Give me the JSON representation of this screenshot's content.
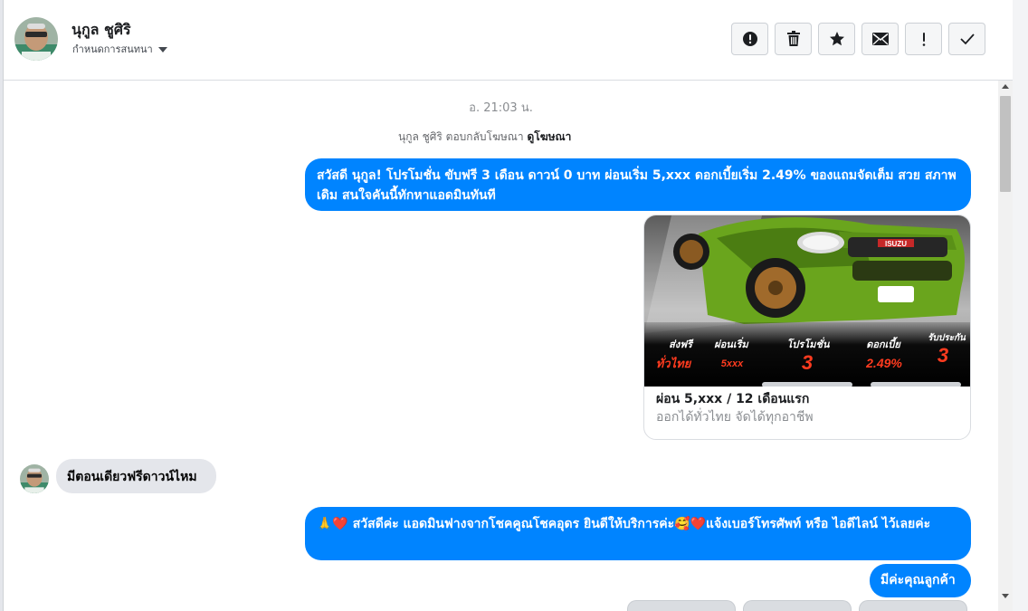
{
  "header": {
    "name": "นุกูล ชูศิริ",
    "subtitle": "กำหนดการสนทนา",
    "actions": [
      {
        "icon": "alert-circle-icon"
      },
      {
        "icon": "trash-icon"
      },
      {
        "icon": "star-icon"
      },
      {
        "icon": "envelope-icon"
      },
      {
        "icon": "exclamation-icon"
      },
      {
        "icon": "check-icon"
      }
    ]
  },
  "thread": {
    "timestamp": "อ. 21:03 น.",
    "reply_note": "นุกูล ชูศิริ ตอบกลับโฆษณา",
    "reply_link": "ดูโฆษณา",
    "messages": [
      {
        "direction": "outgoing",
        "text": "สวัสดี นุกูล! โปรโมชั่น ขับฟรี 3 เดือน ดาวน์ 0 บาท ผ่อนเริ่ม 5,xxx  ดอกเบี้ยเริ่ม 2.49% ของแถมจัดเต็ม สวย สภาพเดิม สนใจคันนี้ทักหาแอดมินทันที"
      },
      {
        "direction": "outgoing",
        "type": "card",
        "title": "ผ่อน 5,xxx / 12 เดือนแรก",
        "subtitle": "ออกได้ทั่วไทย จัดได้ทุกอาชีพ"
      },
      {
        "direction": "incoming",
        "text": "มีตอนเดียวฟรีดาวน์ไหม"
      },
      {
        "direction": "outgoing",
        "text": "🙏❤️ สวัสดีค่ะ แอดมินฟางจากโชคคูณโชคอุดร ยินดีให้บริการค่ะ🥰❤️แจ้งเบอร์โทรศัพท์ หรือ ไอดีไลน์  ไว้เลยค่ะ"
      },
      {
        "direction": "outgoing",
        "text": "มีค่ะคุณลูกค้า"
      }
    ]
  },
  "ad_image": {
    "brand": "ISUZU",
    "promos": [
      {
        "label": "ส่งฟรี",
        "value": "ทั่วไทย"
      },
      {
        "label": "ผ่อนเริ่ม",
        "value": "5xxx"
      },
      {
        "label": "โปรโมชั่น",
        "value": "3"
      },
      {
        "label": "ดอกเบี้ย",
        "value": "2.49%"
      },
      {
        "label": "รับประกัน",
        "value": "3"
      }
    ]
  },
  "colors": {
    "outgoing_bubble": "#0084ff",
    "incoming_bubble": "#e4e6eb",
    "car_green": "#6aa51d"
  }
}
